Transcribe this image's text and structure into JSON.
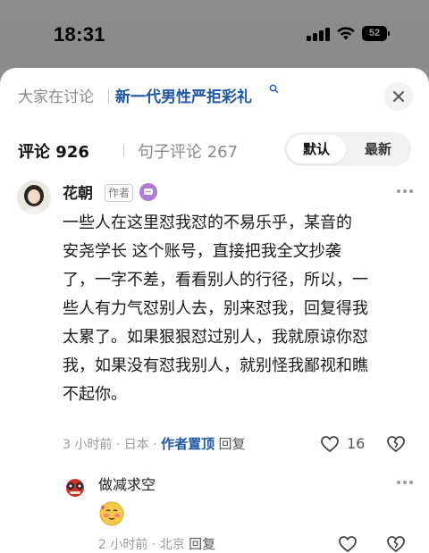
{
  "status_bar": {
    "time": "18:31",
    "battery": "52"
  },
  "header": {
    "discuss_label": "大家在讨论",
    "topic_title": "新一代男性严拒彩礼"
  },
  "tabs": {
    "comments": "评论 926",
    "sentence_comments": "句子评论 267",
    "sort_default": "默认",
    "sort_latest": "最新"
  },
  "comments": [
    {
      "username": "花朝",
      "tag": "作者",
      "text": "一些人在这里怼我怼的不易乐乎，某音的\n安尧学长 这个账号，直接把我全文抄袭\n了，一字不差，看看别人的行径，所以，一\n些人有力气怼别人去，别来怼我，回复得我\n太累了。如果狠狠怼过别人，我就原谅你怼\n我，如果没有怼我别人，就别怪我鄙视和瞧\n不起你。",
      "time_loc": "3 小时前 · 日本 · ",
      "pinned": "作者置顶",
      "reply": "回复",
      "likes": "16"
    },
    {
      "username": "做减求空",
      "time_loc": "2 小时前 · 北京 ",
      "reply": "回复"
    }
  ],
  "colors": {
    "accent": "#1e56a8",
    "muted": "#9a9a9a"
  }
}
